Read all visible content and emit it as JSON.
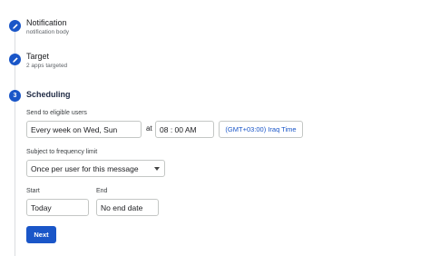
{
  "steps": [
    {
      "title": "Notification",
      "subtitle": "notification body",
      "state": "done"
    },
    {
      "title": "Target",
      "subtitle": "2 apps targeted",
      "state": "done"
    },
    {
      "title": "Scheduling",
      "number": "3",
      "state": "active"
    }
  ],
  "scheduling": {
    "send_label": "Send to eligible users",
    "recurrence_value": "Every week on Wed, Sun",
    "at_label": "at",
    "time_value": "08 : 00  AM",
    "timezone_value": "(GMT+03:00) Iraq Time",
    "frequency_label": "Subject to frequency limit",
    "frequency_value": "Once per user for this message",
    "start_label": "Start",
    "start_value": "Today",
    "end_label": "End",
    "end_value": "No end date",
    "next_label": "Next"
  },
  "colors": {
    "accent": "#1a56c8",
    "border": "#c4c7c5"
  }
}
